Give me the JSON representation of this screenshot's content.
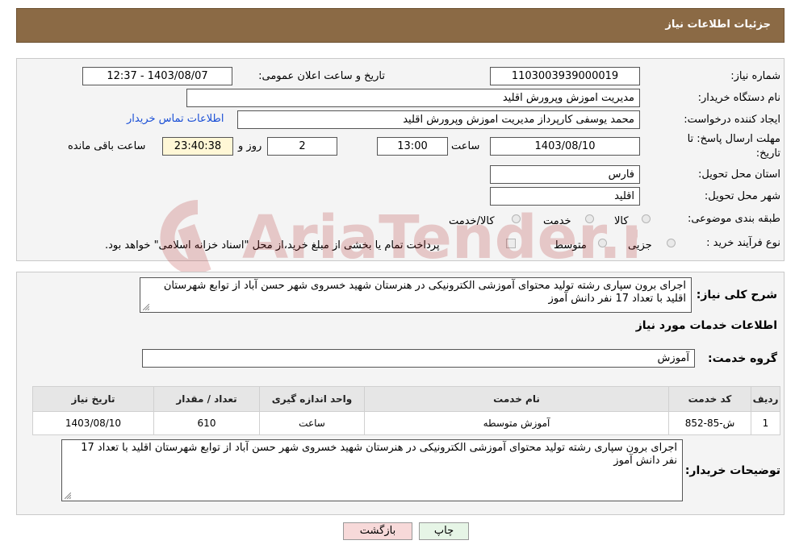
{
  "header": {
    "title": "جزئیات اطلاعات نیاز"
  },
  "form": {
    "need_number_label": "شماره نیاز:",
    "need_number": "1103003939000019",
    "announce_label": "تاریخ و ساعت اعلان عمومی:",
    "announce_value": "1403/08/07 - 12:37",
    "buyer_org_label": "نام دستگاه خریدار:",
    "buyer_org": "مدیریت اموزش وپرورش اقلید",
    "creator_label": "ایجاد کننده درخواست:",
    "creator": "محمد یوسفی کارپرداز مدیریت اموزش وپرورش اقلید",
    "contact_link": "اطلاعات تماس خریدار",
    "deadline_label_1": "مهلت ارسال پاسخ: تا",
    "deadline_label_2": "تاریخ:",
    "deadline_date": "1403/08/10",
    "time_label": "ساعت",
    "deadline_time": "13:00",
    "days": "2",
    "day_label": "روز و",
    "remaining": "23:40:38",
    "remaining_label": "ساعت باقی مانده",
    "province_label": "استان محل تحویل:",
    "province": "فارس",
    "city_label": "شهر محل تحویل:",
    "city": "اقلید",
    "category_label": "طبقه بندی موضوعی:",
    "category_options": [
      "کالا",
      "خدمت",
      "کالا/خدمت"
    ],
    "process_label": "نوع فرآیند خرید :",
    "process_options": [
      "جزیی",
      "متوسط"
    ],
    "payment_note": "پرداخت تمام یا بخشی از مبلغ خرید،از محل \"اسناد خزانه اسلامی\" خواهد بود."
  },
  "details": {
    "summary_label": "شرح کلی نیاز:",
    "summary": "اجرای برون سپاری رشته تولید محتوای آموزشی الکترونیکی در هنرستان شهید خسروی شهر حسن آباد از توابع شهرستان اقلید با تعداد 17 نفر دانش آموز",
    "services_heading": "اطلاعات خدمات مورد نیاز",
    "service_group_label": "گروه خدمت:",
    "service_group": "آموزش",
    "table": {
      "headers": [
        "ردیف",
        "کد خدمت",
        "نام خدمت",
        "واحد اندازه گیری",
        "تعداد / مقدار",
        "تاریخ نیاز"
      ],
      "rows": [
        [
          "1",
          "ش-85-852",
          "آموزش متوسطه",
          "ساعت",
          "610",
          "1403/08/10"
        ]
      ]
    },
    "buyer_notes_label": "توضیحات خریدار:",
    "buyer_notes": "اجرای برون سپاری رشته تولید محتوای آموزشی الکترونیکی در هنرستان شهید خسروی شهر حسن آباد از توابع شهرستان اقلید با تعداد 17 نفر دانش آموز"
  },
  "buttons": {
    "print": "چاپ",
    "back": "بازگشت"
  },
  "watermark": {
    "text": "AriaTender.neT"
  },
  "colors": {
    "header_bg": "#8b6a45",
    "link": "#1a4fd6",
    "back_button_bg": "#f7d9d9",
    "print_button_bg": "#e6f5e6"
  }
}
